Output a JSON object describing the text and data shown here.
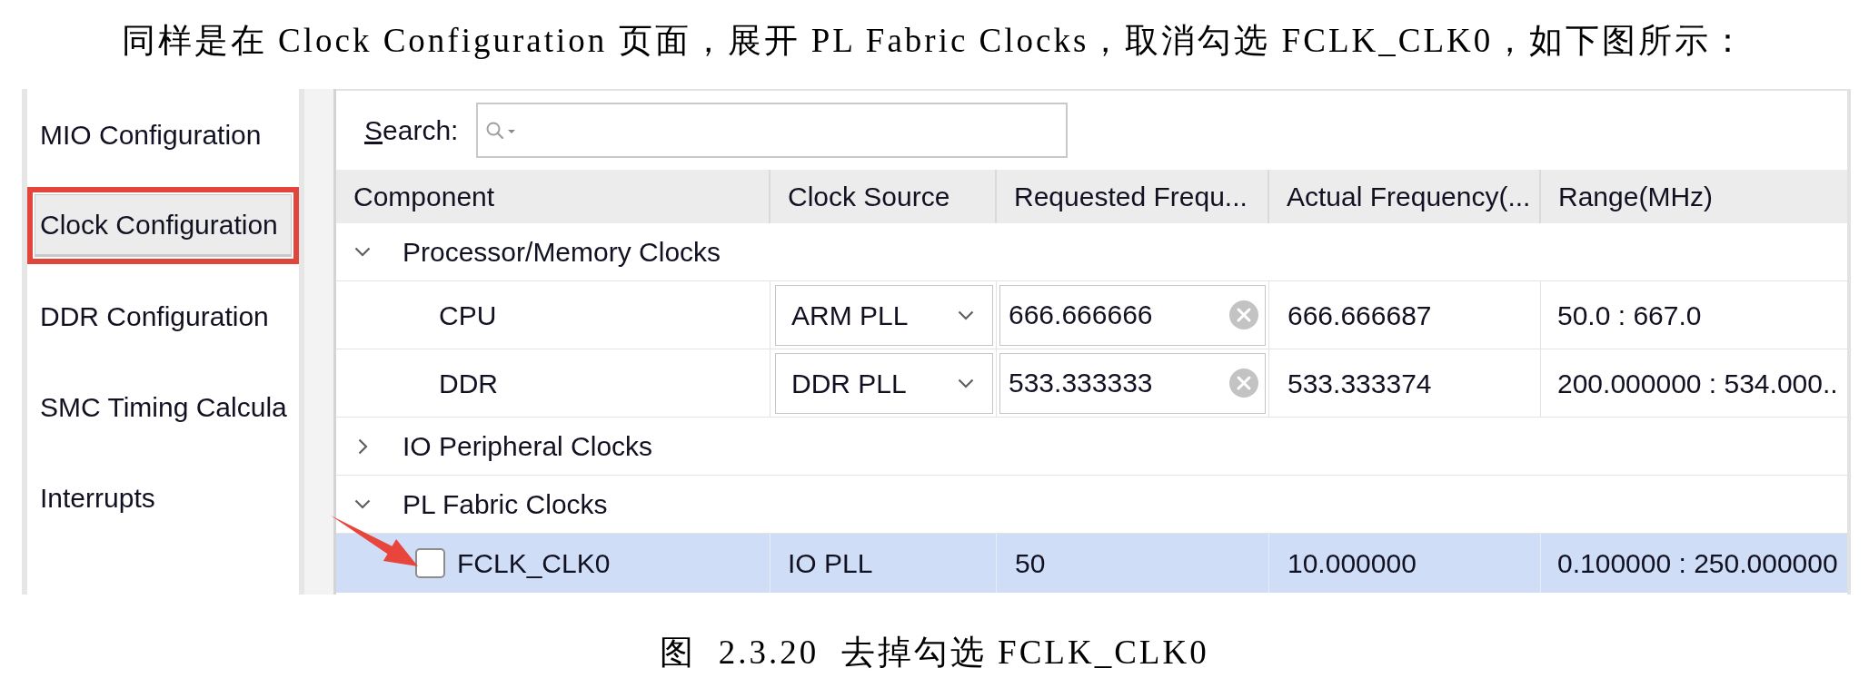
{
  "caption": "同样是在 Clock Configuration 页面，展开 PL Fabric Clocks，取消勾选 FCLK_CLK0，如下图所示：",
  "sidebar": {
    "items": [
      {
        "label": "MIO Configuration",
        "selected": false,
        "outlined": false
      },
      {
        "label": "Clock Configuration",
        "selected": true,
        "outlined": true
      },
      {
        "label": "DDR Configuration",
        "selected": false,
        "outlined": false
      },
      {
        "label": "SMC Timing Calcula",
        "selected": false,
        "outlined": false
      },
      {
        "label": "Interrupts",
        "selected": false,
        "outlined": false
      }
    ]
  },
  "search": {
    "label": "Search:"
  },
  "table": {
    "columns": [
      "Component",
      "Clock Source",
      "Requested Frequ...",
      "Actual Frequency(...",
      "Range(MHz)"
    ],
    "rows": [
      {
        "kind": "group",
        "label": "Processor/Memory Clocks",
        "expanded": true,
        "selected": false,
        "annotated": false
      },
      {
        "kind": "editable",
        "component": "CPU",
        "clock_source": "ARM PLL",
        "requested": "666.666666",
        "actual": "666.666687",
        "range": "50.0 : 667.0",
        "selected": false,
        "annotated": false
      },
      {
        "kind": "editable",
        "component": "DDR",
        "clock_source": "DDR PLL",
        "requested": "533.333333",
        "actual": "533.333374",
        "range": "200.000000 : 534.000..",
        "selected": false,
        "annotated": false
      },
      {
        "kind": "group",
        "label": "IO Peripheral Clocks",
        "expanded": false,
        "selected": false,
        "annotated": false
      },
      {
        "kind": "group",
        "label": "PL Fabric Clocks",
        "expanded": true,
        "selected": false,
        "annotated": false
      },
      {
        "kind": "checkable",
        "component": "FCLK_CLK0",
        "checked": false,
        "clock_source": "IO PLL",
        "requested": "50",
        "actual": "10.000000",
        "range": "0.100000 : 250.000000",
        "selected": true,
        "annotated": true
      }
    ]
  },
  "figure_caption": "图  2.3.20  去掉勾选 FCLK_CLK0"
}
